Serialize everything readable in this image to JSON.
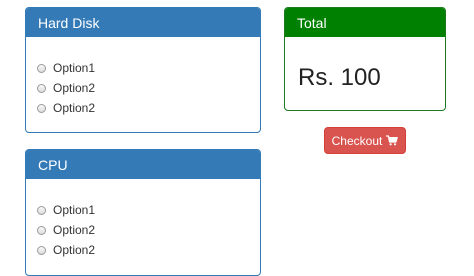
{
  "hard_disk": {
    "title": "Hard Disk",
    "options": [
      "Option1",
      "Option2",
      "Option2"
    ]
  },
  "cpu": {
    "title": "CPU",
    "options": [
      "Option1",
      "Option2",
      "Option2"
    ]
  },
  "total": {
    "title": "Total",
    "amount": "Rs. 100"
  },
  "checkout": {
    "label": "Checkout",
    "icon": "cart-icon"
  },
  "colors": {
    "primary": "#337ab7",
    "success": "#008000",
    "danger": "#d9534f"
  }
}
